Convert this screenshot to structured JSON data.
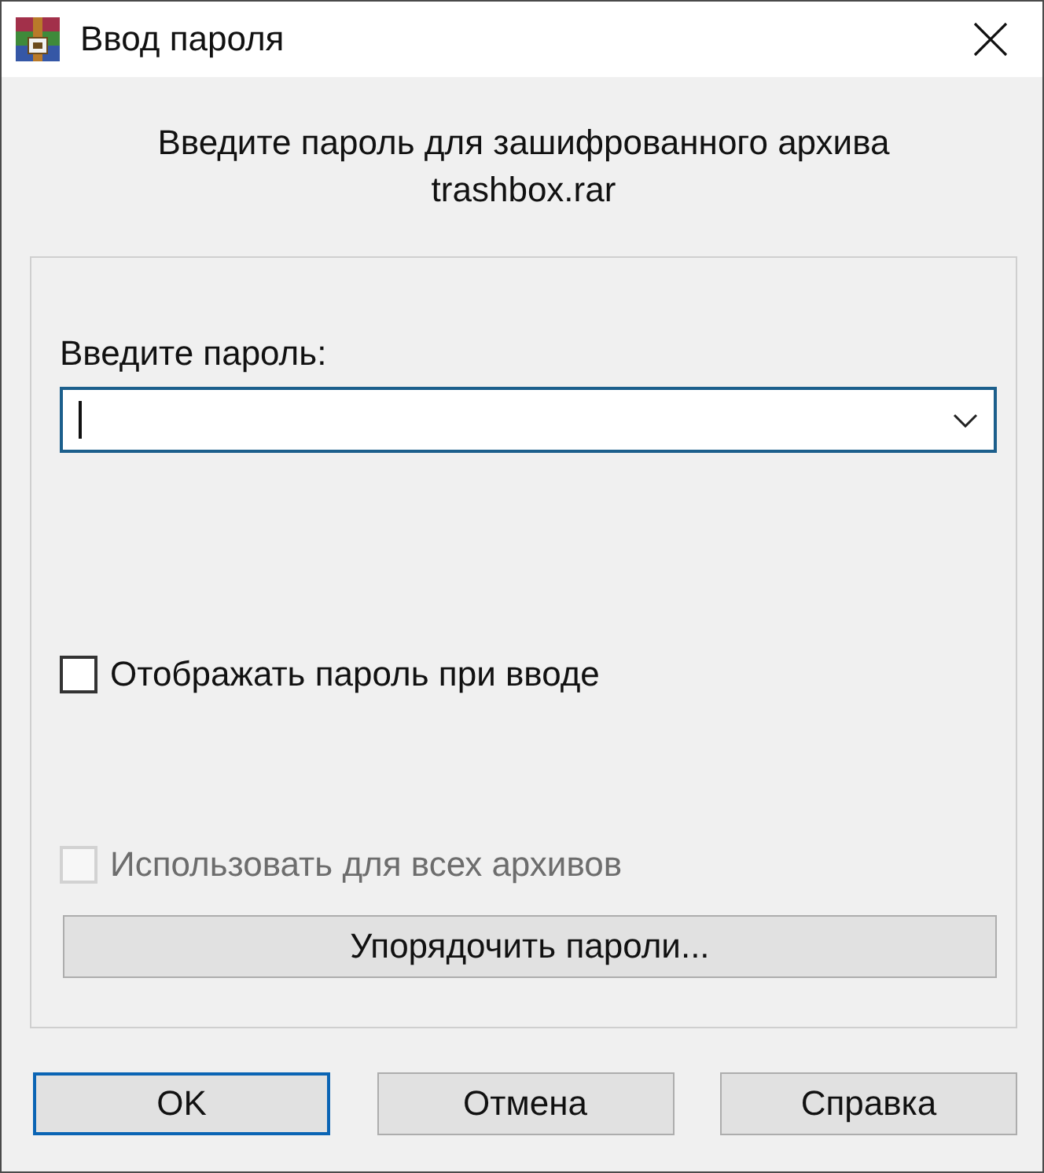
{
  "window": {
    "title": "Ввод пароля"
  },
  "message": {
    "line_1": "Введите пароль для зашифрованного архива",
    "line_2": "trashbox.rar"
  },
  "password": {
    "label": "Введите пароль:",
    "focused": true
  },
  "options": [
    {
      "label": "Отображать пароль при вводе",
      "checked": false,
      "disabled": false
    },
    {
      "label": "Использовать для всех архивов",
      "checked": false,
      "disabled": true
    }
  ],
  "organize_button": {
    "label": "Упорядочить пароли..."
  },
  "buttons": [
    {
      "label": "OK",
      "default": true
    },
    {
      "label": "Отмена",
      "default": false
    },
    {
      "label": "Справка",
      "default": false
    }
  ]
}
